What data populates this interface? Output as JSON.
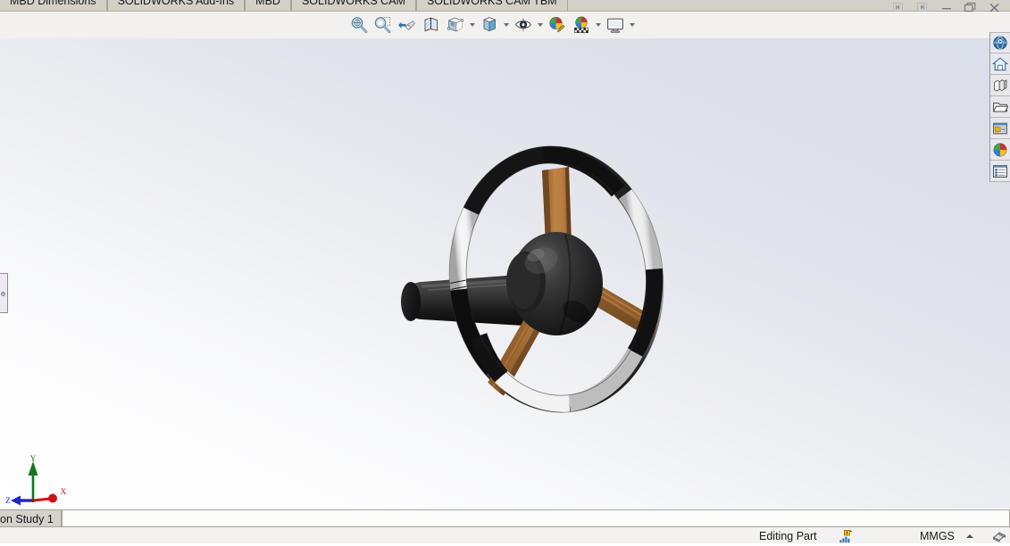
{
  "window": {
    "controls": [
      {
        "name": "nav-previous",
        "glyph": "prev"
      },
      {
        "name": "nav-next",
        "glyph": "next"
      },
      {
        "name": "minimize",
        "glyph": "minimize"
      },
      {
        "name": "restore",
        "glyph": "restore"
      },
      {
        "name": "close",
        "glyph": "close"
      }
    ]
  },
  "ribbon": {
    "tabs": [
      {
        "label": "MBD Dimensions"
      },
      {
        "label": "SOLIDWORKS Add-Ins"
      },
      {
        "label": "MBD"
      },
      {
        "label": "SOLIDWORKS CAM"
      },
      {
        "label": "SOLIDWORKS CAM TBM"
      }
    ]
  },
  "toolbar": {
    "buttons": [
      {
        "name": "zoom-to-fit-icon",
        "tooltip": "Zoom to Fit",
        "caret": false
      },
      {
        "name": "zoom-to-area-icon",
        "tooltip": "Zoom to Area",
        "caret": false
      },
      {
        "name": "previous-view-icon",
        "tooltip": "Previous View",
        "caret": false
      },
      {
        "name": "section-view-icon",
        "tooltip": "Section View",
        "caret": false
      },
      {
        "name": "view-orientation-icon",
        "tooltip": "View Orientation",
        "caret": false
      },
      {
        "name": "display-style-icon",
        "tooltip": "Display Style",
        "caret": true
      },
      {
        "name": "view-cube-icon",
        "tooltip": "Display Style",
        "caret": true
      },
      {
        "name": "hide-show-items-icon",
        "tooltip": "Hide/Show Items",
        "caret": true
      },
      {
        "name": "edit-appearance-icon",
        "tooltip": "Edit Appearance",
        "caret": false
      },
      {
        "name": "apply-scene-icon",
        "tooltip": "Apply Scene",
        "caret": true
      },
      {
        "name": "view-settings-icon",
        "tooltip": "View Settings",
        "caret": true
      }
    ]
  },
  "taskpane": {
    "buttons": [
      {
        "name": "3d-contentcentral-icon",
        "tooltip": "3D ContentCentral"
      },
      {
        "name": "design-library-icon",
        "tooltip": "Design Library"
      },
      {
        "name": "appearances-blocks-icon",
        "tooltip": "Appearances, Scenes and Decals"
      },
      {
        "name": "file-explorer-icon",
        "tooltip": "File Explorer"
      },
      {
        "name": "view-palette-icon",
        "tooltip": "View Palette"
      },
      {
        "name": "appearances-scenes-icon",
        "tooltip": "Appearances"
      },
      {
        "name": "custom-properties-icon",
        "tooltip": "Custom Properties"
      }
    ]
  },
  "viewport": {
    "background_top": "#dbdfe9",
    "background_bottom": "#ffffff",
    "model_name": "handwheel",
    "triad": {
      "axes": [
        {
          "label": "Y",
          "color": "#0a7a16"
        },
        {
          "label": "X",
          "color": "#d40f14"
        },
        {
          "label": "Z",
          "color": "#1a25cf"
        }
      ]
    },
    "model_colors": {
      "rim_chrome_light": "#ffffff",
      "rim_chrome_mid": "#b7b7b7",
      "rim_dark": "#141414",
      "spoke_bronze": "#b4793c",
      "spoke_bronze_dark": "#8d5c2b",
      "hub_dark": "#2a2a2a",
      "shaft_dark": "#1d1d1d"
    }
  },
  "motion_study": {
    "tab_label": "on Study 1"
  },
  "statusbar": {
    "editing_mode": "Editing Part",
    "units": "MMGS",
    "sensor_icon": "sensor-warning-icon",
    "rebuild_icon": "rebuild-icon"
  }
}
